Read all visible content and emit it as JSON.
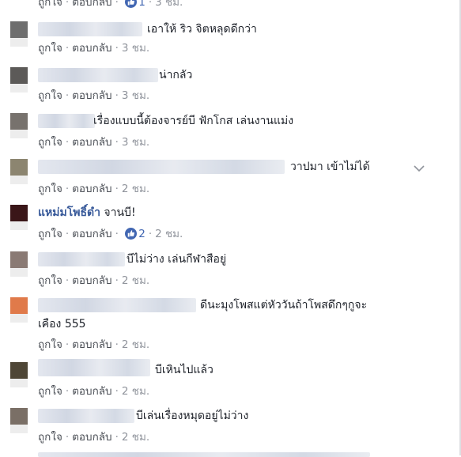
{
  "comments": [
    {
      "text": "",
      "like": "ถูกใจ",
      "reply": "ตอบกลับ",
      "likes": "1",
      "time": "3 ชม."
    },
    {
      "text": "เอาให้ ริว จิตหลุดดีกว่า",
      "like": "ถูกใจ",
      "reply": "ตอบกลับ",
      "time": "3 ชม."
    },
    {
      "text": "น่ากลัว",
      "like": "ถูกใจ",
      "reply": "ตอบกลับ",
      "time": "3 ชม."
    },
    {
      "text": "เรื่องแบบนี้ต้องจารย์บี ฟักโกส เล่นงานแม่ง",
      "like": "ถูกใจ",
      "reply": "ตอบกลับ",
      "time": "3 ชม."
    },
    {
      "text": "วาปมา เข้าไม่ได้",
      "like": "ถูกใจ",
      "reply": "ตอบกลับ",
      "time": "2 ชม."
    },
    {
      "author": "แหม่มโพธิ์ดำ",
      "text": "จานบี!",
      "like": "ถูกใจ",
      "reply": "ตอบกลับ",
      "likes": "2",
      "time": "2 ชม."
    },
    {
      "text": "บีไม่ว่าง เล่นกีฬาสือยู่",
      "like": "ถูกใจ",
      "reply": "ตอบกลับ",
      "time": "2 ชม."
    },
    {
      "text": "ดีนะมุงโพสแต่หัววันถ้าโพสดึกๆกูจะ",
      "text2": "เคือง 555",
      "like": "ถูกใจ",
      "reply": "ตอบกลับ",
      "time": "2 ชม."
    },
    {
      "text": "บีเหินไปแล้ว",
      "like": "ถูกใจ",
      "reply": "ตอบกลับ",
      "time": "2 ชม."
    },
    {
      "text": "บีเล่นเรื่องหมุดอยู่ไม่ว่าง",
      "like": "ถูกใจ",
      "reply": "ตอบกลับ",
      "time": "2 ชม."
    }
  ],
  "colors": {
    "link": "#365899",
    "meta": "#90949c",
    "like_icon": "#4267b2"
  },
  "icons": [
    "like-reaction-icon",
    "chevron-down-icon"
  ]
}
